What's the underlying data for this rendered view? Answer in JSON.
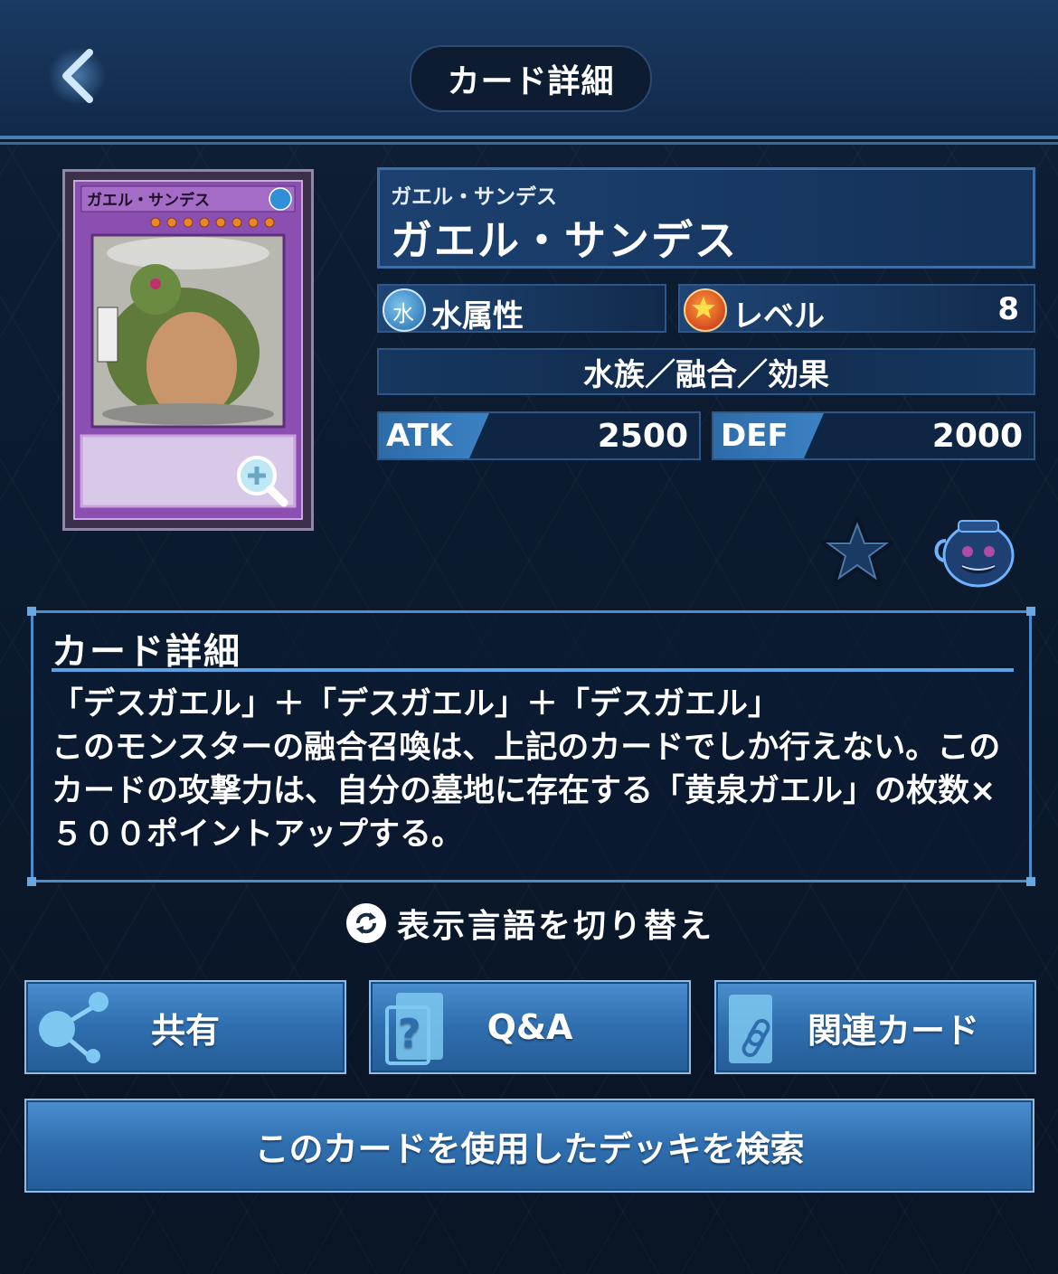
{
  "header": {
    "title": "カード詳細"
  },
  "card": {
    "ruby": "ガエル・サンデス",
    "name": "ガエル・サンデス",
    "image_title": "ガエル・サンデス",
    "attribute_label": "水属性",
    "attribute_icon_char": "水",
    "level_label": "レベル",
    "level_value": "8",
    "type_line": "水族／融合／効果",
    "atk_label": "ATK",
    "atk_value": "2500",
    "def_label": "DEF",
    "def_value": "2000"
  },
  "detail": {
    "title": "カード詳細",
    "text": "「デスガエル」＋「デスガエル」＋「デスガエル」\nこのモンスターの融合召喚は、上記のカードでしか行えない。このカードの攻撃力は、自分の墓地に存在する「黄泉ガエル」の枚数×５００ポイントアップする。"
  },
  "lang_switch_label": "表示言語を切り替え",
  "buttons": {
    "share": "共有",
    "qa": "Q&A",
    "related": "関連カード",
    "search_decks": "このカードを使用したデッキを検索"
  },
  "colors": {
    "bg": "#0b1a2e",
    "accent_blue": "#3b82c4",
    "panel_border": "#4d8cc9",
    "card_frame_purple": "#8a4fb0"
  },
  "icons": {
    "back": "chevron-left-icon",
    "favorite": "star-icon",
    "pot": "pot-of-greed-icon",
    "zoom": "magnifier-plus-icon",
    "share": "share-nodes-icon",
    "qa": "question-icon",
    "related": "link-card-icon",
    "lang": "refresh-icon"
  }
}
